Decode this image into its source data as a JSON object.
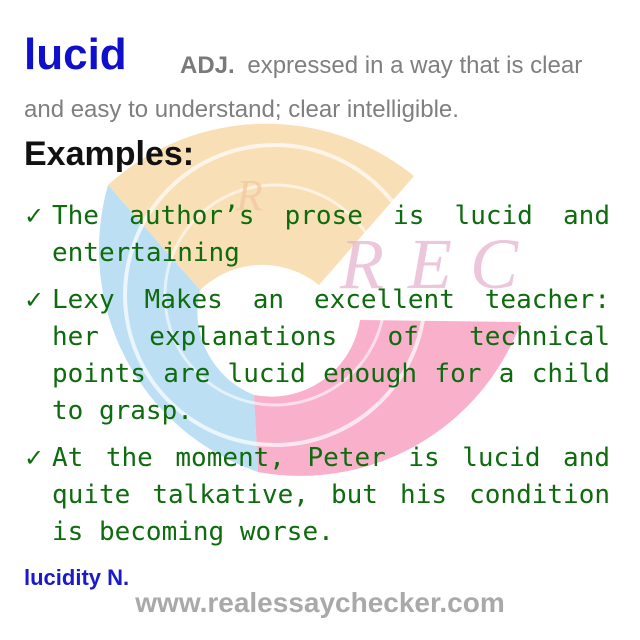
{
  "entry": {
    "word": "lucid",
    "part_of_speech": "ADJ.",
    "definition": "expressed in a way that is clear and easy to understand; clear intelligible."
  },
  "examples_heading": "Examples:",
  "examples": [
    {
      "check": "✓",
      "text": "The author’s prose is lucid and entertaining"
    },
    {
      "check": "✓",
      "text": "Lexy Makes an excellent teacher: her explanations of technical points are lucid enough for a child to grasp."
    },
    {
      "check": "✓",
      "text": "At the moment, Peter is lucid and quite talkative, but his condition is becoming worse."
    }
  ],
  "derived_form": "lucidity N.",
  "watermark": {
    "logo_text": "REC",
    "colors": {
      "orange": "#f9dcae",
      "pink": "#f9a8c6",
      "blue": "#b5dcf3",
      "letters": "#e6b3d0"
    }
  },
  "footer": {
    "site": "www.realessaychecker.com"
  },
  "colors": {
    "headword": "#1010cc",
    "definition": "#7f7f7f",
    "examples": "#0e6b0e",
    "derived": "#1a1acc",
    "footer": "#a9a9a9"
  }
}
